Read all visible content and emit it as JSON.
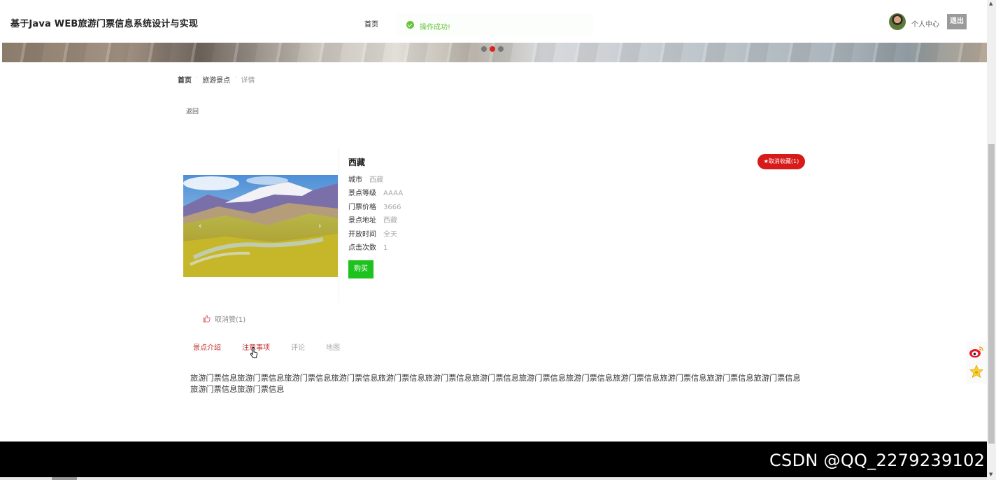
{
  "header": {
    "site_title": "基于Java WEB旅游门票信息系统设计与实现",
    "nav_home": "首页",
    "toast_message": "操作成功!",
    "user_center": "个人中心",
    "logout": "退出"
  },
  "banner": {
    "slide_count": 3,
    "active_slide": 2
  },
  "breadcrumb": {
    "items": [
      "首页",
      "旅游景点",
      "详情"
    ],
    "back": "返回"
  },
  "spot": {
    "name": "西藏",
    "favorite_button": "★取消收藏(1)",
    "info": [
      {
        "label": "城市",
        "value": "西藏"
      },
      {
        "label": "景点等级",
        "value": "AAAA"
      },
      {
        "label": "门票价格",
        "value": "3666"
      },
      {
        "label": "景点地址",
        "value": "西藏"
      },
      {
        "label": "开放时间",
        "value": "全天"
      },
      {
        "label": "点击次数",
        "value": "1"
      }
    ],
    "buy_button": "购买",
    "unlike": "取消赞(1)",
    "gallery_prev": "‹",
    "gallery_next": "›"
  },
  "tabs": {
    "items": [
      "景点介绍",
      "注意事项",
      "评论",
      "地图"
    ],
    "content": "旅游门票信息旅游门票信息旅游门票信息旅游门票信息旅游门票信息旅游门票信息旅游门票信息旅游门票信息旅游门票信息旅游门票信息旅游门票信息旅游门票信息旅游门票信息旅游门票信息旅游门票信息"
  },
  "footer": {
    "watermark": "CSDN @QQ_2279239102"
  },
  "colors": {
    "success": "#67c23a",
    "favorite_red": "#d71a1a",
    "buy_green": "#1ec21e",
    "tab_active": "#c03030"
  },
  "icons": [
    "check-circle-icon",
    "avatar",
    "thumb-up-icon",
    "weibo-icon",
    "star-icon",
    "pointer-cursor-icon"
  ]
}
